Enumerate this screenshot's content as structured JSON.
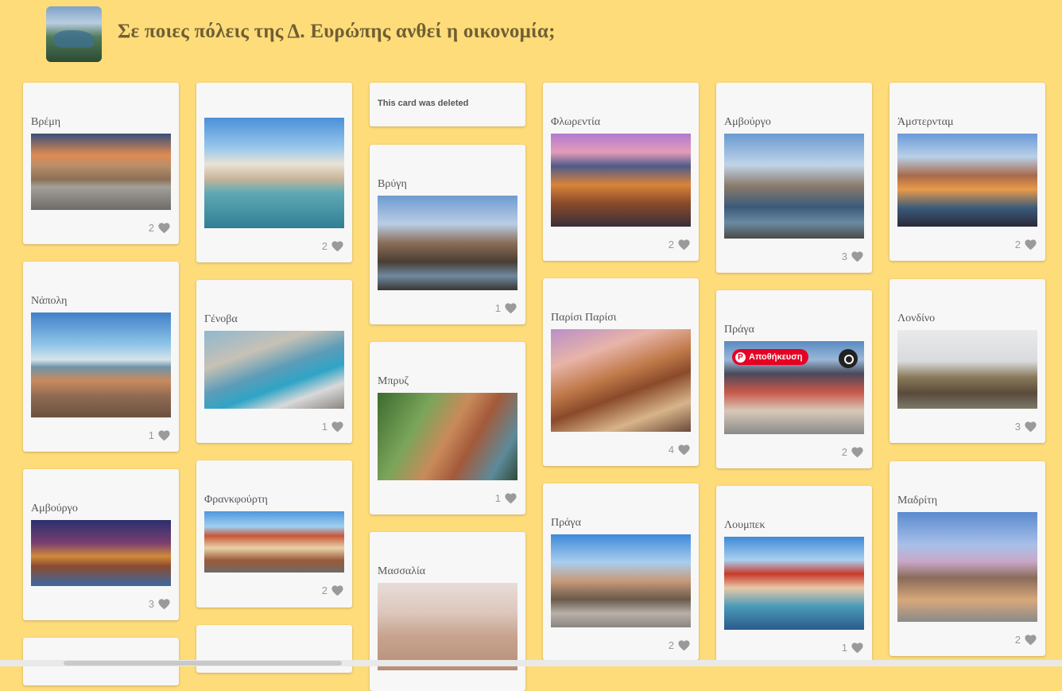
{
  "header": {
    "title": "Σε ποιες πόλεις της Δ. Ευρώπης ανθεί η οικονομία;"
  },
  "deleted_card": {
    "text": "This card was deleted"
  },
  "pin_overlay": {
    "save_label": "Αποθήκευση"
  },
  "colors": {
    "background": "#ffdc7a",
    "heart": "#9a9a9a",
    "pinterest": "#e60023"
  },
  "cards": [
    {
      "caption": "Βρέμη",
      "likes": "2",
      "image": "bremen-square-photo"
    },
    {
      "caption": "Νάπολη",
      "likes": "1",
      "image": "naples-panorama-photo"
    },
    {
      "caption": "Αμβούργο",
      "likes": "3",
      "image": "hamburg-speicherstadt-photo"
    },
    {
      "caption": "",
      "likes": "2",
      "image": "venice-rialto-photo"
    },
    {
      "caption": "Γένοβα",
      "likes": "1",
      "image": "genoa-port-photo"
    },
    {
      "caption": "Φρανκφούρτη",
      "likes": "2",
      "image": "frankfurt-romer-photo"
    },
    {
      "caption": "Βρύγη",
      "likes": "1",
      "image": "bruges-canal-photo"
    },
    {
      "caption": "Μπρυζ",
      "likes": "1",
      "image": "bruges-houses-photo"
    },
    {
      "caption": "Μασσαλία",
      "likes": "",
      "image": "marseille-photo"
    },
    {
      "caption": "Φλωρεντία",
      "likes": "2",
      "image": "florence-duomo-photo"
    },
    {
      "caption": "Παρίσι Παρίσι",
      "likes": "4",
      "image": "paris-street-photo"
    },
    {
      "caption": "Πράγα",
      "likes": "2",
      "image": "prague-old-town-photo"
    },
    {
      "caption": "Αμβούργο",
      "likes": "3",
      "image": "hamburg-aerial-photo"
    },
    {
      "caption": "Πράγα",
      "likes": "2",
      "image": "prague-aerial-photo"
    },
    {
      "caption": "Λουμπεκ",
      "likes": "1",
      "image": "lubeck-photo"
    },
    {
      "caption": "Άμστερνταμ",
      "likes": "2",
      "image": "amsterdam-canal-photo"
    },
    {
      "caption": "Λονδίνο",
      "likes": "3",
      "image": "london-westminster-photo"
    },
    {
      "caption": "Μαδρίτη",
      "likes": "2",
      "image": "madrid-plaza-mayor-photo"
    }
  ]
}
